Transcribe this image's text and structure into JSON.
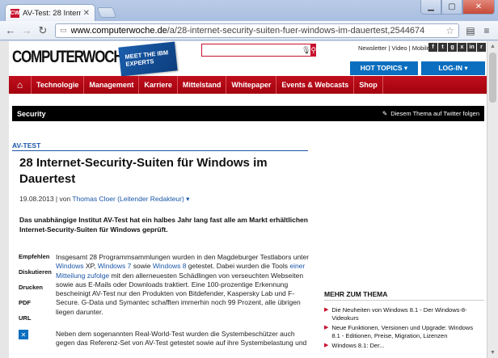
{
  "browser": {
    "tab_title": "AV-Test: 28 Internet-Securi",
    "tab_favicon": "CW",
    "url_domain": "www.computerwoche.de",
    "url_path": "/a/28-internet-security-suiten-fuer-windows-im-dauertest,2544674"
  },
  "header": {
    "logo_text": "COMPUTERWOCHE",
    "promo_text": "MEET THE IBM EXPERTS",
    "search_placeholder": "",
    "top_links": "Newsletter | Video | Mobile",
    "hot_topics": "HOT TOPICS ▾",
    "login": "LOG-IN ▾"
  },
  "nav": {
    "items": [
      "Technologie",
      "Management",
      "Karriere",
      "Mittelstand",
      "Whitepaper",
      "Events & Webcasts",
      "Shop"
    ]
  },
  "section": {
    "label": "Security",
    "twitter": "Diesem Thema auf Twitter folgen"
  },
  "article": {
    "kicker": "AV-TEST",
    "headline": "28 Internet-Security-Suiten für Windows im Dauertest",
    "date": "19.08.2013 | von ",
    "author": "Thomas Cloer (Leitender Redakteur) ▾",
    "lead": "Das unabhängige Institut AV-Test hat ein halbes Jahr lang fast alle am Markt erhältlichen Internet-Security-Suiten für Windows geprüft.",
    "tools": [
      "Empfehlen",
      "Diskutieren",
      "Drucken",
      "PDF",
      "URL"
    ],
    "body1_a": "Insgesamt 28 Programmsammlungen wurden in den Magdeburger Testlabors unter ",
    "body1_l1": "Windows",
    "body1_b": " XP, ",
    "body1_l2": "Windows 7",
    "body1_c": " sowie ",
    "body1_l3": "Windows 8",
    "body1_d": " getestet. Dabei wurden die Tools ",
    "body1_l4": "einer Mitteilung zufolge",
    "body1_e": " mit den allerneuesten Schädlingen von verseuchten Webseiten sowie aus E-Mails oder Downloads traktiert. Eine 100-prozentige Erkennung bescheinigt AV-Test nur den Produkten von Bitdefender, Kaspersky Lab und F-Secure. G-Data und Symantec schafften immerhin noch 99 Prozent, alle übrigen liegen darunter.",
    "body2": "Neben dem sogenannten Real-World-Test wurden die Systembeschützer auch gegen das Referenz-Set von AV-Test getestet sowie auf ihre Systembelastung und"
  },
  "sidebar": {
    "heading": "MEHR ZUM THEMA",
    "items": [
      "Die Neuheiten von Windows 8.1 - Der Windows-8-Videokurs",
      "Neue Funktionen, Versionen und Upgrade: Windows 8.1 - Editionen, Preise, Migration, Lizenzen",
      "Windows 8.1: Der..."
    ]
  },
  "colors": {
    "brand_red": "#c8102e",
    "link_blue": "#1a56a8",
    "button_blue": "#0b6ebf"
  }
}
